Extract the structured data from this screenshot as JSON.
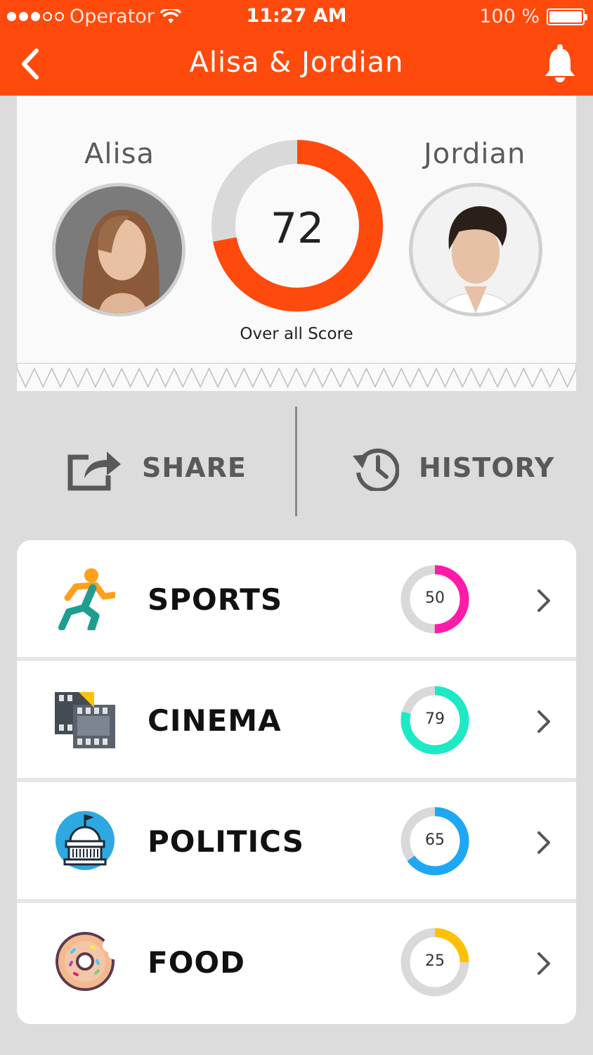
{
  "status_bar": {
    "carrier": "Operator",
    "time": "11:27 AM",
    "battery": "100 %"
  },
  "nav": {
    "title": "Alisa & Jordian",
    "back_icon": "chevron-left-icon",
    "bell_icon": "bell-icon"
  },
  "match": {
    "left_name": "Alisa",
    "right_name": "Jordian",
    "overall_score": "72",
    "overall_score_value": 72,
    "overall_label": "Over all Score",
    "colors": {
      "accent": "#ff4a0d",
      "track": "#d9d9d9"
    }
  },
  "actions": {
    "share": "SHARE",
    "history": "HISTORY"
  },
  "categories": [
    {
      "label": "SPORTS",
      "score": "50",
      "value": 50,
      "color": "#ff1aa8",
      "icon": "runner-icon"
    },
    {
      "label": "CINEMA",
      "score": "79",
      "value": 79,
      "color": "#1de9c5",
      "icon": "film-icon"
    },
    {
      "label": "POLITICS",
      "score": "65",
      "value": 65,
      "color": "#1ea7f5",
      "icon": "capitol-icon"
    },
    {
      "label": "FOOD",
      "score": "25",
      "value": 25,
      "color": "#ffc107",
      "icon": "donut-icon"
    }
  ]
}
